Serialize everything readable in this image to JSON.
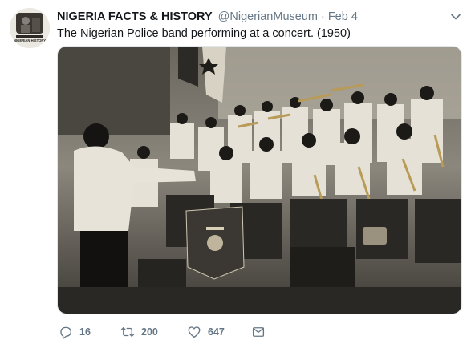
{
  "tweet": {
    "author_name": "NIGERIA FACTS & HISTORY",
    "author_handle": "@NigerianMuseum",
    "separator": "·",
    "date": "Feb 4",
    "text": "The Nigerian Police band performing at a concert. (1950)",
    "avatar_caption": "NIGERIAN HISTORY",
    "media_alt": "Black and white photograph of the Nigerian Police band performing on stage with a conductor in the foreground"
  },
  "actions": {
    "replies": "16",
    "retweets": "200",
    "likes": "647",
    "message": ""
  },
  "icons": {
    "reply": "reply-icon",
    "retweet": "retweet-icon",
    "like": "heart-icon",
    "message": "envelope-icon",
    "more": "chevron-down-icon"
  },
  "colors": {
    "text": "#14171a",
    "secondary": "#657786",
    "photo_sepia": "#d9d4c8"
  }
}
